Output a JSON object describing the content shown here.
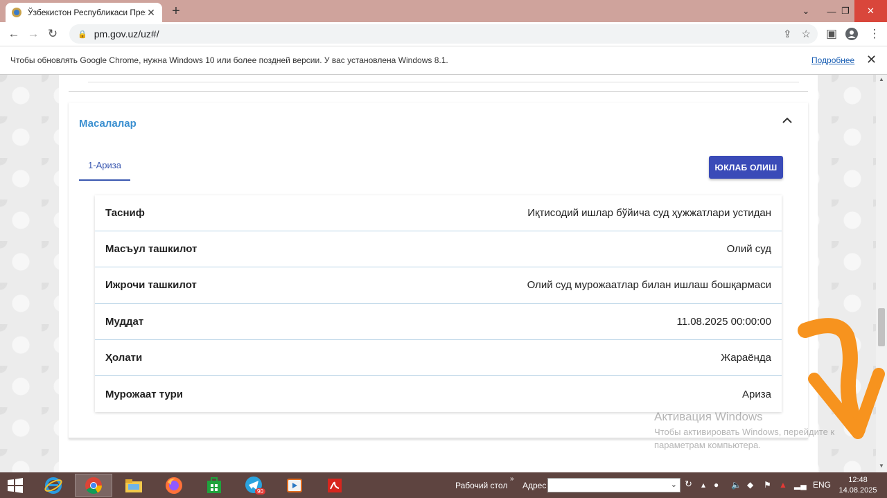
{
  "browser": {
    "tab_title": "Ўзбекистон Республикаси Прези",
    "url": "pm.gov.uz/uz#/"
  },
  "infobar": {
    "message": "Чтобы обновлять Google Chrome, нужна Windows 10 или более поздней версии. У вас установлена Windows 8.1.",
    "link": "Подробнее"
  },
  "section": {
    "title": "Масалалар",
    "tab_label": "1-Ариза",
    "download_label": "ЮКЛАБ ОЛИШ"
  },
  "rows": [
    {
      "key": "Тасниф",
      "value": "Иқтисодий ишлар бўйича суд ҳужжатлари устидан"
    },
    {
      "key": "Масъул ташкилот",
      "value": "Олий суд"
    },
    {
      "key": "Ижрочи ташкилот",
      "value": "Олий суд мурожаатлар билан ишлаш бошқармаси"
    },
    {
      "key": "Муддат",
      "value": "11.08.2025 00:00:00"
    },
    {
      "key": "Ҳолати",
      "value": "Жараёнда"
    },
    {
      "key": "Мурожаат тури",
      "value": "Ариза"
    }
  ],
  "watermark": {
    "title": "Активация Windows",
    "line1": "Чтобы активировать Windows, перейдите к",
    "line2": "параметрам компьютера."
  },
  "taskbar": {
    "desktop_label": "Рабочий стол",
    "address_label": "Адрес",
    "lang": "ENG",
    "time": "12:48",
    "date": "14.08.2025",
    "telegram_badge": "90"
  },
  "colors": {
    "accent": "#3a8fd0",
    "button": "#3a4bb8",
    "annotation_arrow": "#f7931e"
  }
}
